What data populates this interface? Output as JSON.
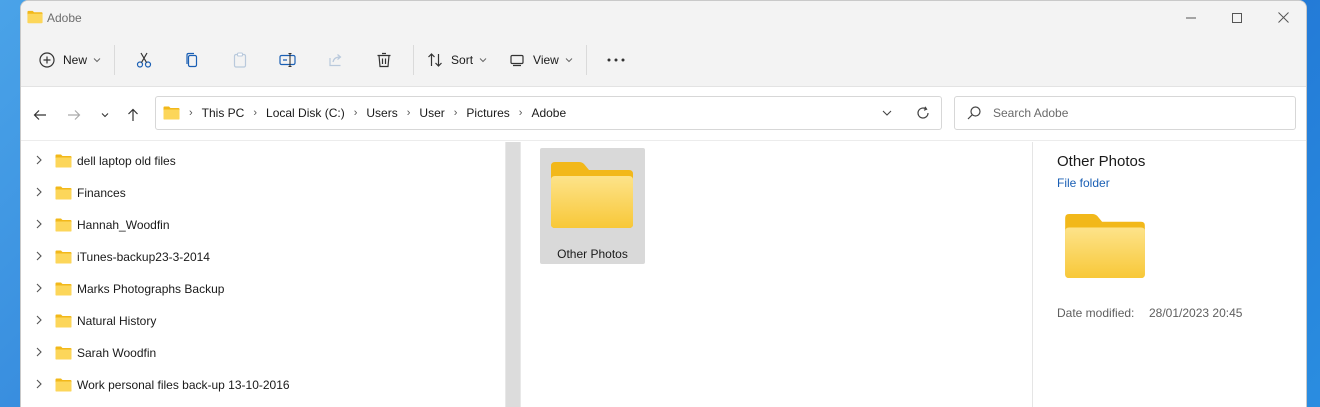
{
  "window": {
    "title": "Adobe"
  },
  "toolbar": {
    "new_label": "New",
    "sort_label": "Sort",
    "view_label": "View"
  },
  "address": {
    "crumbs": [
      "This PC",
      "Local Disk (C:)",
      "Users",
      "User",
      "Pictures",
      "Adobe"
    ]
  },
  "search": {
    "placeholder": "Search Adobe"
  },
  "navpane": {
    "items": [
      {
        "label": "dell laptop old files"
      },
      {
        "label": "Finances"
      },
      {
        "label": "Hannah_Woodfin"
      },
      {
        "label": "iTunes-backup23-3-2014"
      },
      {
        "label": "Marks Photographs Backup"
      },
      {
        "label": "Natural History"
      },
      {
        "label": "Sarah Woodfin"
      },
      {
        "label": "Work personal files back-up 13-10-2016"
      }
    ]
  },
  "files": [
    {
      "name": "Other Photos",
      "selected": true
    }
  ],
  "details": {
    "title": "Other Photos",
    "type": "File folder",
    "date_key": "Date modified:",
    "date_value": "28/01/2023 20:45"
  },
  "colors": {
    "folder_back": "#f2b81a",
    "folder_front": "#fcd65a",
    "accent": "#1a5fb4"
  }
}
